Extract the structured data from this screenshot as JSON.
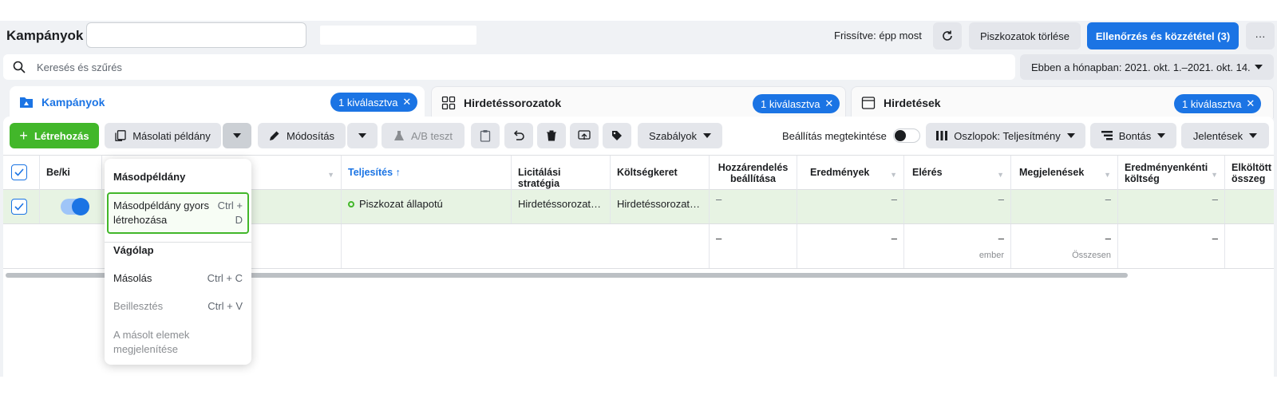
{
  "header": {
    "title": "Kampányok",
    "refresh_status": "Frissítve: épp most",
    "discard_drafts": "Piszkozatok törlése",
    "review_publish": "Ellenőrzés és közzététel (3)",
    "more": "···"
  },
  "search": {
    "placeholder": "Keresés és szűrés",
    "date_range": "Ebben a hónapban: 2021. okt. 1.–2021. okt. 14."
  },
  "tabs": [
    {
      "label": "Kampányok",
      "badge": "1 kiválasztva"
    },
    {
      "label": "Hirdetéssorozatok",
      "badge": "1 kiválasztva"
    },
    {
      "label": "Hirdetések",
      "badge": "1 kiválasztva"
    }
  ],
  "toolbar": {
    "create": "Létrehozás",
    "duplicate": "Másolati példány",
    "edit": "Módosítás",
    "ab_test": "A/B teszt",
    "rules": "Szabályok",
    "view_setup": "Beállítás megtekintése",
    "columns": "Oszlopok: Teljesítmény",
    "breakdown": "Bontás",
    "reports": "Jelentések"
  },
  "table": {
    "headers": {
      "onoff": "Be/ki",
      "delivery": "Teljesítés ↑",
      "bid_strategy": "Licitálási stratégia",
      "budget": "Költségkeret",
      "attribution": "Hozzárendelés beállítása",
      "results": "Eredmények",
      "reach": "Elérés",
      "impressions": "Megjelenések",
      "cost_per_result": "Eredményenkénti költség",
      "amount_spent": "Elköltött összeg"
    },
    "row": {
      "delivery": "Piszkozat állapotú",
      "bid_strategy": "Hirdetéssorozat…",
      "budget": "Hirdetéssorozat…",
      "dash": "–"
    },
    "summary": {
      "dash": "–",
      "reach_unit": "ember",
      "impressions_unit": "Összesen"
    }
  },
  "menu": {
    "section_duplicate": "Másodpéldány",
    "quick_duplicate": "Másodpéldány gyors létrehozása",
    "quick_duplicate_shortcut": "Ctrl + D",
    "section_clipboard": "Vágólap",
    "copy": "Másolás",
    "copy_shortcut": "Ctrl + C",
    "paste": "Beillesztés",
    "paste_shortcut": "Ctrl + V",
    "show_copied": "A másolt elemek megjelenítése"
  },
  "colors": {
    "accent_blue": "#1b74e4",
    "create_green": "#42b72a",
    "row_selected": "#e7f3e3"
  }
}
